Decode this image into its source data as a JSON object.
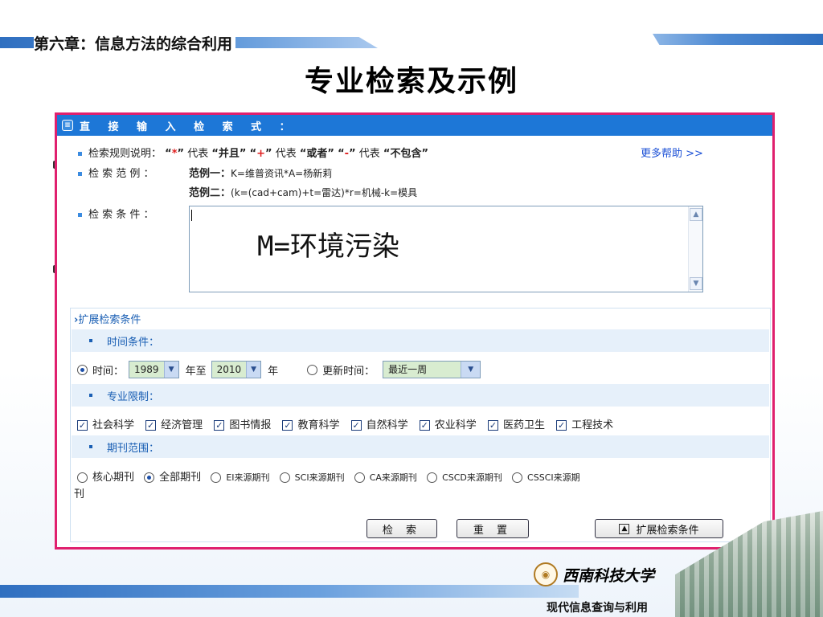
{
  "slide": {
    "chapter_title": "第六章：信息方法的综合利用",
    "title": "专业检索及示例",
    "university_logo_text": "西南科技大学",
    "footer_label": "现代信息查询与利用"
  },
  "panel": {
    "header_title": "直 接 输 入 检 索 式 ：",
    "rules": {
      "label": "检索规则说明：",
      "q1": "“*”",
      "t1": "代表",
      "v1": "“并且”",
      "q2": "“+”",
      "t2": "代表",
      "v2": "“或者”",
      "q3": "“-”",
      "t3": "代表",
      "v3": "“不包含”",
      "help_link": "更多帮助 >>"
    },
    "examples": {
      "label": "检 索 范 例 ：",
      "ex1_label": "范例一：",
      "ex1_value": "K=维普资讯*A=杨新莉",
      "ex2_label": "范例二：",
      "ex2_value": "(k=(cad+cam)+t=雷达)*r=机械-k=模具"
    },
    "condition": {
      "label": "检 索 条 件 ：",
      "value": "M=环境污染"
    },
    "extended": {
      "title": "扩展检索条件",
      "time_band": "时间条件：",
      "time_label": "时间：",
      "year_from": "1989",
      "year_to_label": "年至",
      "year_to": "2010",
      "year_suffix": "年",
      "update_label": "更新时间：",
      "update_value": "最近一周",
      "subject_band": "专业限制：",
      "subjects": [
        "社会科学",
        "经济管理",
        "图书情报",
        "教育科学",
        "自然科学",
        "农业科学",
        "医药卫生",
        "工程技术"
      ],
      "journal_band": "期刊范围：",
      "journals": [
        "核心期刊",
        "全部期刊",
        "EI来源期刊",
        "SCI来源期刊",
        "CA来源期刊",
        "CSCD来源期刊",
        "CSSCI来源期"
      ],
      "journal_wrap": "刊",
      "journal_selected_index": 1
    },
    "buttons": {
      "search": "检 索",
      "reset": "重 置",
      "expand": "扩展检索条件"
    }
  },
  "colors": {
    "panel_border": "#e0206e",
    "header_bg": "#1d77d7",
    "band_bg": "#e6f0fa",
    "link": "#1a4fd6"
  }
}
